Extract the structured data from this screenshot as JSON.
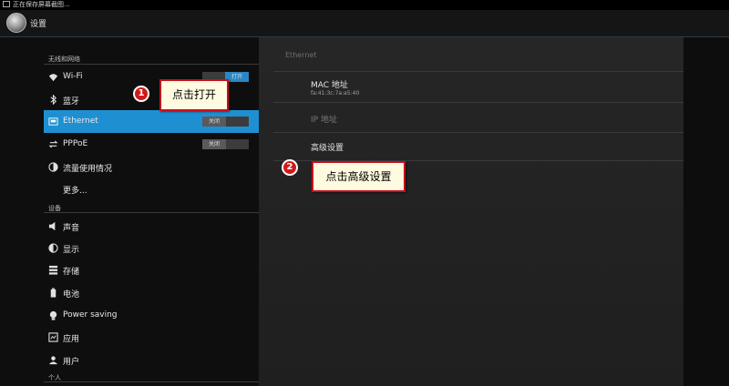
{
  "status_bar": {
    "text": "正在保存屏幕截图..."
  },
  "app_bar": {
    "title": "设置"
  },
  "sidebar": {
    "sections": [
      {
        "header": "无线和网络"
      },
      {
        "header": "设备"
      },
      {
        "header": "个人"
      }
    ],
    "items": [
      {
        "label": "Wi-Fi",
        "toggle": "打开",
        "toggle_state": "on"
      },
      {
        "label": "蓝牙"
      },
      {
        "label": "Ethernet",
        "toggle": "关闭",
        "toggle_state": "off",
        "selected": true
      },
      {
        "label": "PPPoE",
        "toggle": "关闭",
        "toggle_state": "off"
      },
      {
        "label": "流量使用情况"
      },
      {
        "label": "更多..."
      },
      {
        "label": "声音"
      },
      {
        "label": "显示"
      },
      {
        "label": "存储"
      },
      {
        "label": "电池"
      },
      {
        "label": "Power saving"
      },
      {
        "label": "应用"
      },
      {
        "label": "用户"
      }
    ]
  },
  "detail": {
    "title": "Ethernet",
    "mac_label": "MAC 地址",
    "mac_value": "fa:41:3c:7a:a5:40",
    "ip_label": "IP 地址",
    "advanced_label": "高级设置"
  },
  "annotations": [
    {
      "number": "1",
      "text": "点击打开"
    },
    {
      "number": "2",
      "text": "点击高级设置"
    }
  ],
  "colors": {
    "accent": "#1e90d2",
    "callout_border": "#c8101c",
    "callout_bg": "#fffbe0"
  }
}
